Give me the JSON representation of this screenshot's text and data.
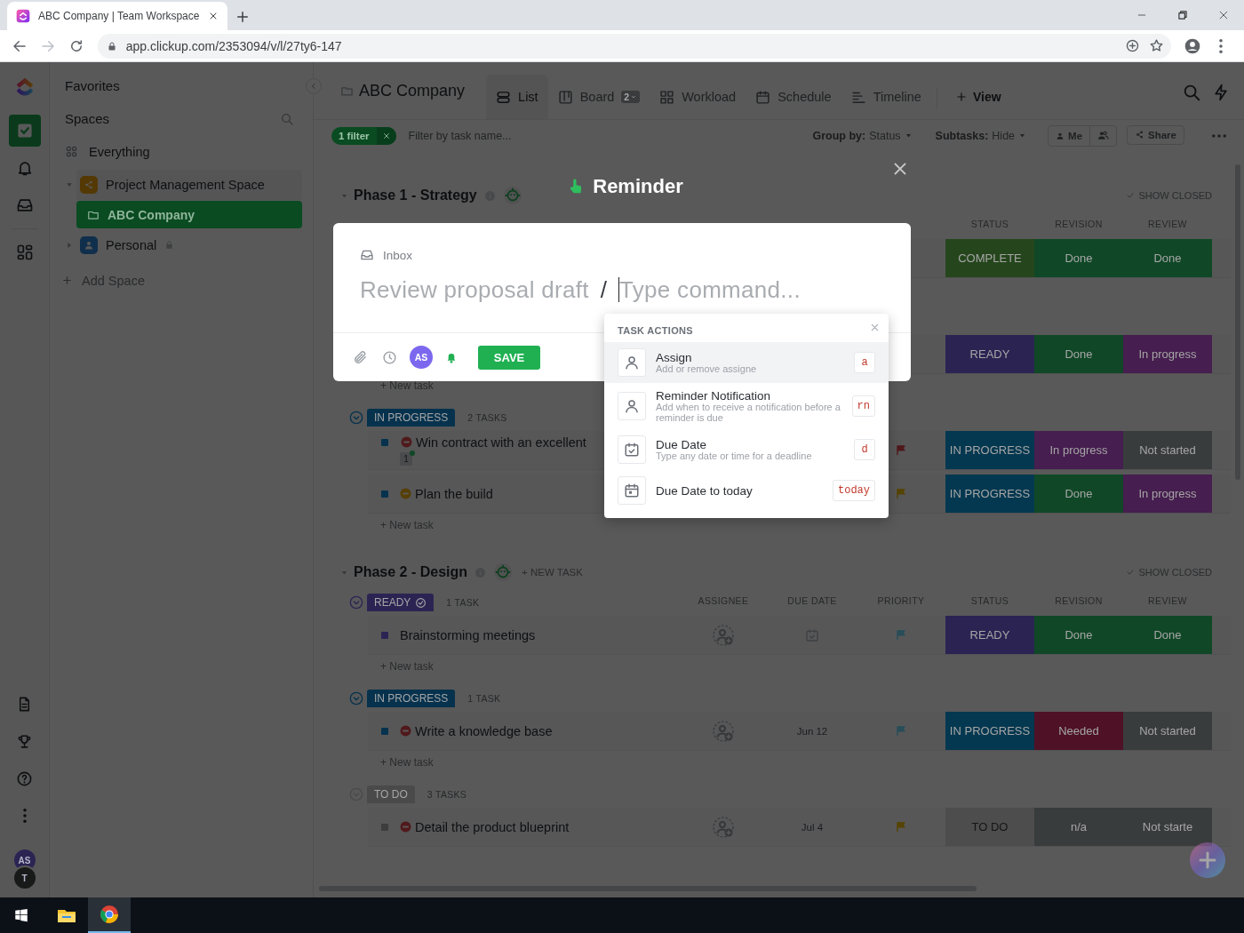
{
  "browser": {
    "tab_title": "ABC Company | Team Workspace",
    "url": "app.clickup.com/2353094/v/l/27ty6-147"
  },
  "rail": {
    "items": [
      {
        "kind": "home",
        "selected": true
      },
      {
        "kind": "bell",
        "selected": false
      },
      {
        "kind": "inbox",
        "selected": false
      },
      {
        "kind": "apps",
        "selected": false
      }
    ],
    "avatars": [
      {
        "initials": "AS",
        "color": "#2b2453"
      },
      {
        "initials": "T",
        "color": "#181919"
      }
    ]
  },
  "sidebar": {
    "favorites": "Favorites",
    "spaces_heading": "Spaces",
    "everything": "Everything",
    "spaces": [
      {
        "kind": "share",
        "label": "Project Management Space",
        "color": "#543904",
        "expanded": true,
        "locked": false,
        "children": [
          {
            "label": "ABC Company",
            "selected": true
          }
        ]
      },
      {
        "kind": "person",
        "label": "Personal",
        "color": "#102f4c",
        "expanded": false,
        "locked": true
      }
    ],
    "add_space": "Add Space"
  },
  "header": {
    "title": "ABC Company",
    "views": [
      {
        "kind": "list",
        "label": "List",
        "selected": true
      },
      {
        "kind": "board",
        "label": "Board",
        "badge": "2",
        "selected": false
      },
      {
        "kind": "workload",
        "label": "Workload",
        "selected": false
      },
      {
        "kind": "schedule",
        "label": "Schedule",
        "selected": false
      },
      {
        "kind": "timeline",
        "label": "Timeline",
        "selected": false
      }
    ],
    "add_view": "View"
  },
  "filters": {
    "chip": "1 filter",
    "search_placeholder": "Filter by task name...",
    "group_by_label": "Group by:",
    "group_by_value": "Status",
    "subtasks_label": "Subtasks:",
    "subtasks_value": "Hide",
    "me": "Me",
    "share": "Share"
  },
  "phases": [
    {
      "title": "Phase 1 - Strategy",
      "show_closed": "SHOW CLOSED",
      "columns": [
        {
          "kind": "status",
          "label": "STATUS"
        },
        {
          "kind": "revision",
          "label": "REVISION"
        },
        {
          "kind": "review",
          "label": "REVIEW"
        }
      ],
      "groups": [
        {
          "rows": [
            {
              "status": {
                "text": "COMPLETE",
                "color": "#25461c"
              },
              "revision": {
                "text": "Done",
                "color": "#104827"
              },
              "review": {
                "text": "Done",
                "color": "#104827"
              }
            }
          ]
        },
        {
          "rows": [
            {
              "status": {
                "text": "READY",
                "color": "#2b2453"
              },
              "revision": {
                "text": "Done",
                "color": "#104827"
              },
              "review": {
                "text": "In progress",
                "color": "#461e4f"
              }
            }
          ],
          "new_task": "+ New task"
        },
        {
          "label": "IN PROGRESS",
          "color": "#06324e",
          "count": "2 TASKS",
          "rows": [
            {
              "name": "Win contract with an excellent",
              "square": {
                "color": "#06324e"
              },
              "mark": {
                "color": "#50191b"
              },
              "subtasks": "1",
              "flag": {
                "color": "#50191b"
              },
              "status": {
                "text": "IN PROGRESS",
                "color": "#043850"
              },
              "revision": {
                "text": "In progress",
                "color": "#461e4f"
              },
              "review": {
                "text": "Not started",
                "color": "#393c3d"
              }
            },
            {
              "name": "Plan the build",
              "square": {
                "color": "#06324e"
              },
              "mark": {
                "color": "#563f00"
              },
              "flag": {
                "color": "#564400"
              },
              "status": {
                "text": "IN PROGRESS",
                "color": "#043850"
              },
              "revision": {
                "text": "Done",
                "color": "#104827"
              },
              "review": {
                "text": "In progress",
                "color": "#461e4f"
              }
            }
          ],
          "new_task": "+ New task"
        }
      ]
    },
    {
      "title": "Phase 2 - Design",
      "new_task": "+ NEW TASK",
      "show_closed": "SHOW CLOSED",
      "columns": [
        {
          "kind": "assignee",
          "label": "ASSIGNEE"
        },
        {
          "kind": "due",
          "label": "DUE DATE"
        },
        {
          "kind": "priority",
          "label": "PRIORITY"
        },
        {
          "kind": "status",
          "label": "STATUS"
        },
        {
          "kind": "revision",
          "label": "REVISION"
        },
        {
          "kind": "review",
          "label": "REVIEW"
        }
      ],
      "groups": [
        {
          "label": "READY",
          "color": "#2b2453",
          "done_icon": true,
          "count": "1 TASK",
          "rows": [
            {
              "name": "Brainstorming meetings",
              "square": {
                "color": "#2b2453"
              },
              "assignee_placeholder": true,
              "due_placeholder": true,
              "flag": {
                "color": "#274d59"
              },
              "status": {
                "text": "READY",
                "color": "#2b2453"
              },
              "revision": {
                "text": "Done",
                "color": "#104827"
              },
              "review": {
                "text": "Done",
                "color": "#104827"
              }
            }
          ],
          "new_task": "+ New task"
        },
        {
          "label": "IN PROGRESS",
          "color": "#06324e",
          "count": "1 TASK",
          "rows": [
            {
              "name": "Write a knowledge base",
              "square": {
                "color": "#06324e"
              },
              "mark": {
                "color": "#50191b"
              },
              "assignee_placeholder": true,
              "due": "Jun 12",
              "flag": {
                "color": "#274d59"
              },
              "status": {
                "text": "IN PROGRESS",
                "color": "#043850"
              },
              "revision": {
                "text": "Needed",
                "color": "#4e1126"
              },
              "review": {
                "text": "Not started",
                "color": "#393c3d"
              }
            }
          ],
          "new_task": "+ New task"
        },
        {
          "label": "TO DO",
          "color": "#4a4a4a",
          "count": "3 TASKS",
          "rows": [
            {
              "name": "Detail the product blueprint",
              "square": {
                "color": "#3d3d3d"
              },
              "mark": {
                "color": "#50191b"
              },
              "assignee_placeholder": true,
              "due": "Jul 4",
              "flag": {
                "color": "#564400"
              },
              "status": {
                "text": "TO DO",
                "color": "#4d4d4d"
              },
              "revision": {
                "text": "n/a",
                "color": "#393c3d"
              },
              "review": {
                "text": "Not starte",
                "color": "#393c3d"
              }
            }
          ]
        }
      ]
    }
  ],
  "modal": {
    "title": "Reminder",
    "location": "Inbox",
    "task_name": "Review proposal draft",
    "separator": "/",
    "command_placeholder": "Type command...",
    "avatar": "AS",
    "save": "SAVE",
    "menu": {
      "heading": "TASK ACTIONS",
      "items": [
        {
          "kind": "person",
          "title": "Assign",
          "hint": "Add or remove assigne",
          "shortcut": "a",
          "selected": true
        },
        {
          "kind": "person",
          "title": "Reminder Notification",
          "hint": "Add when to receive a notification before a reminder is due",
          "shortcut": "rn",
          "selected": false
        },
        {
          "kind": "calendar-check",
          "title": "Due Date",
          "hint": "Type any date or time for a deadline",
          "shortcut": "d",
          "selected": false
        },
        {
          "kind": "calendar",
          "title": "Due Date to today",
          "shortcut": "today",
          "selected": false
        }
      ]
    }
  },
  "taskbar": {
    "apps": [
      {
        "kind": "explorer",
        "selected": false
      },
      {
        "kind": "chrome",
        "selected": true
      }
    ]
  }
}
